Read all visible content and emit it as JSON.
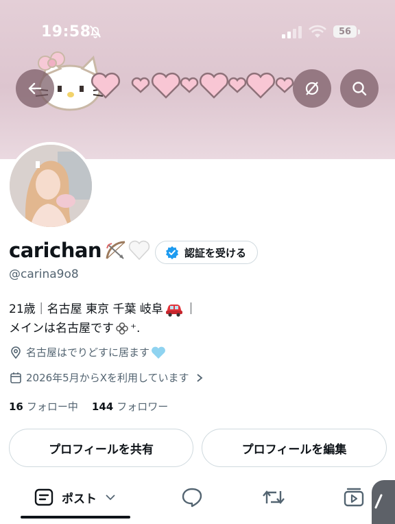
{
  "status_bar": {
    "time": "19:58",
    "battery": "56",
    "icons": [
      "bell-off-icon",
      "signal-icon",
      "wifi-icon",
      "battery-icon"
    ]
  },
  "header_buttons": {
    "back": "arrow-left-icon",
    "grok": "grok-icon",
    "search": "search-icon"
  },
  "profile": {
    "display_name": "carichan",
    "name_emojis": [
      "bow-and-arrow",
      "white-heart"
    ],
    "verify_label": "認証を受ける",
    "handle": "@carina9o8",
    "bio_line1": "21歳｜名古屋 東京 千葉 岐阜",
    "bio_line1_tail": "｜",
    "bio_line2": "メインは名古屋です",
    "bio_line2_tail": "⁺.",
    "location": "名古屋はでりどすに居ます",
    "joined": "2026年5月からXを利用しています",
    "following_count": "16",
    "following_label": "フォロー中",
    "followers_count": "144",
    "followers_label": "フォロワー"
  },
  "actions": {
    "share": "プロフィールを共有",
    "edit": "プロフィールを編集"
  },
  "tabs": {
    "posts_label": "ポスト",
    "icons": [
      "post-icon",
      "reply-icon",
      "repost-icon",
      "media-icon"
    ]
  },
  "colors": {
    "banner": "#e4cfd7",
    "verified_blue": "#1d9bf0",
    "text_primary": "#0f1419",
    "text_secondary": "#536471",
    "border": "#cfd9de",
    "heart_pink": "#f4b8c8"
  }
}
